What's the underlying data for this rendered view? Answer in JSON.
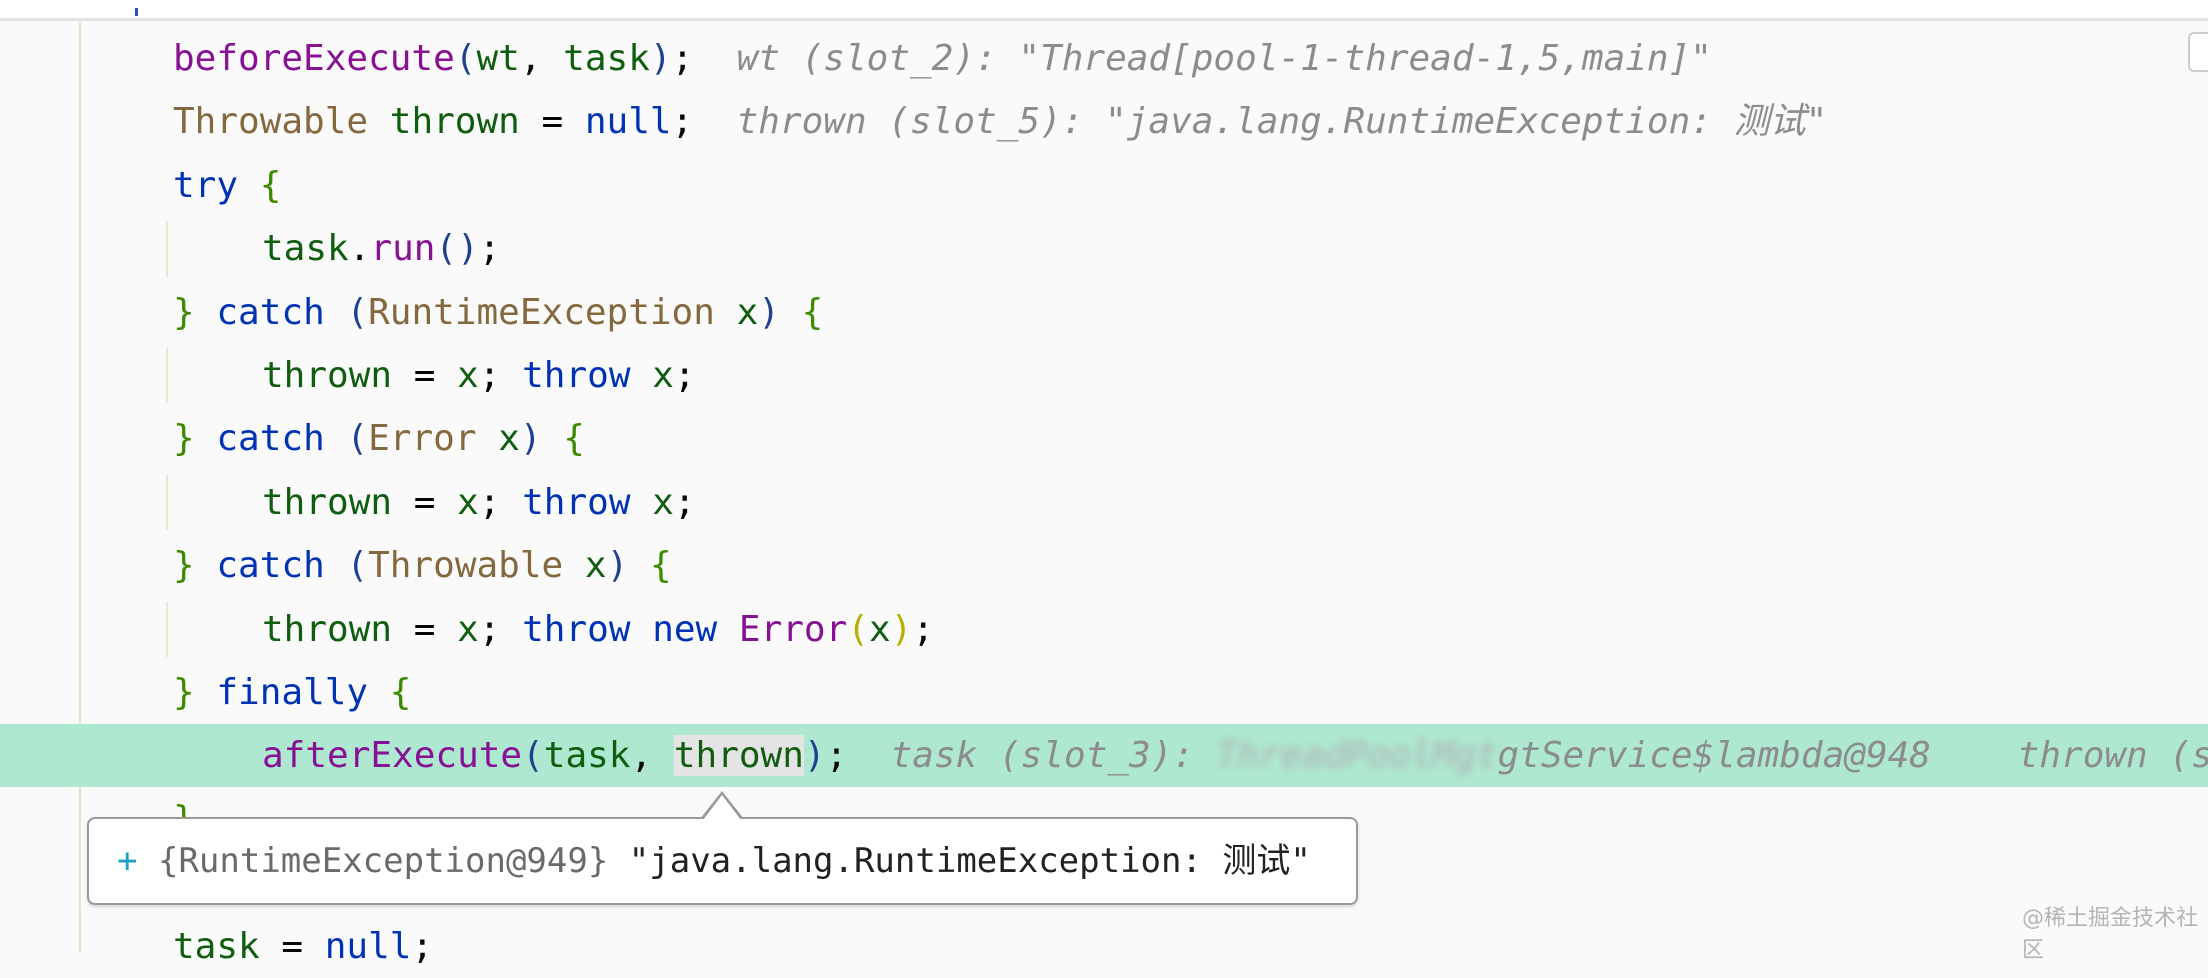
{
  "editor": {
    "lines": [
      {
        "indent": 1,
        "tokens": [
          [
            "beforeExecute",
            "m"
          ],
          [
            "(",
            "p"
          ],
          [
            "wt",
            "v"
          ],
          [
            ", ",
            "d"
          ],
          [
            "task",
            "v"
          ],
          [
            ")",
            "p"
          ],
          [
            ";",
            "d"
          ]
        ],
        "hint": "wt (slot_2): \"Thread[pool-1-thread-1,5,main]\""
      },
      {
        "indent": 1,
        "tokens": [
          [
            "Throwable",
            "t"
          ],
          [
            " ",
            "d"
          ],
          [
            "thrown",
            "v"
          ],
          [
            " = ",
            "d"
          ],
          [
            "null",
            "k"
          ],
          [
            ";",
            "d"
          ]
        ],
        "hint": "thrown (slot_5): \"java.lang.RuntimeException: 测试\""
      },
      {
        "indent": 1,
        "tokens": [
          [
            "try",
            "k"
          ],
          [
            " ",
            "d"
          ],
          [
            "{",
            "b"
          ]
        ]
      },
      {
        "indent": 2,
        "tokens": [
          [
            "task",
            "v"
          ],
          [
            ".",
            "d"
          ],
          [
            "run",
            "m"
          ],
          [
            "()",
            "p"
          ],
          [
            ";",
            "d"
          ]
        ]
      },
      {
        "indent": 1,
        "tokens": [
          [
            "}",
            "b"
          ],
          [
            " ",
            "d"
          ],
          [
            "catch",
            "k"
          ],
          [
            " ",
            "d"
          ],
          [
            "(",
            "p"
          ],
          [
            "RuntimeException",
            "t"
          ],
          [
            " ",
            "d"
          ],
          [
            "x",
            "v"
          ],
          [
            ")",
            "p"
          ],
          [
            " ",
            "d"
          ],
          [
            "{",
            "b"
          ]
        ]
      },
      {
        "indent": 2,
        "tokens": [
          [
            "thrown",
            "v"
          ],
          [
            " = ",
            "d"
          ],
          [
            "x",
            "v"
          ],
          [
            "; ",
            "d"
          ],
          [
            "throw",
            "k"
          ],
          [
            " ",
            "d"
          ],
          [
            "x",
            "v"
          ],
          [
            ";",
            "d"
          ]
        ]
      },
      {
        "indent": 1,
        "tokens": [
          [
            "}",
            "b"
          ],
          [
            " ",
            "d"
          ],
          [
            "catch",
            "k"
          ],
          [
            " ",
            "d"
          ],
          [
            "(",
            "p"
          ],
          [
            "Error",
            "t"
          ],
          [
            " ",
            "d"
          ],
          [
            "x",
            "v"
          ],
          [
            ")",
            "p"
          ],
          [
            " ",
            "d"
          ],
          [
            "{",
            "b"
          ]
        ]
      },
      {
        "indent": 2,
        "tokens": [
          [
            "thrown",
            "v"
          ],
          [
            " = ",
            "d"
          ],
          [
            "x",
            "v"
          ],
          [
            "; ",
            "d"
          ],
          [
            "throw",
            "k"
          ],
          [
            " ",
            "d"
          ],
          [
            "x",
            "v"
          ],
          [
            ";",
            "d"
          ]
        ]
      },
      {
        "indent": 1,
        "tokens": [
          [
            "}",
            "b"
          ],
          [
            " ",
            "d"
          ],
          [
            "catch",
            "k"
          ],
          [
            " ",
            "d"
          ],
          [
            "(",
            "p"
          ],
          [
            "Throwable",
            "t"
          ],
          [
            " ",
            "d"
          ],
          [
            "x",
            "v"
          ],
          [
            ")",
            "p"
          ],
          [
            " ",
            "d"
          ],
          [
            "{",
            "b"
          ]
        ]
      },
      {
        "indent": 2,
        "tokens": [
          [
            "thrown",
            "v"
          ],
          [
            " = ",
            "d"
          ],
          [
            "x",
            "v"
          ],
          [
            "; ",
            "d"
          ],
          [
            "throw",
            "k"
          ],
          [
            " ",
            "d"
          ],
          [
            "new",
            "k"
          ],
          [
            " ",
            "d"
          ],
          [
            "Error",
            "m"
          ],
          [
            "(",
            "y"
          ],
          [
            "x",
            "v"
          ],
          [
            ")",
            "y"
          ],
          [
            ";",
            "d"
          ]
        ]
      },
      {
        "indent": 1,
        "tokens": [
          [
            "}",
            "b"
          ],
          [
            " ",
            "d"
          ],
          [
            "finally",
            "k"
          ],
          [
            " ",
            "d"
          ],
          [
            "{",
            "b"
          ]
        ]
      },
      {
        "indent": 2,
        "highlight": true,
        "tokens": [
          [
            "afterExecute",
            "m"
          ],
          [
            "(",
            "p"
          ],
          [
            "task",
            "v"
          ],
          [
            ", ",
            "d"
          ],
          [
            "thrown",
            "v sel"
          ],
          [
            ")",
            "p"
          ],
          [
            ";",
            "d"
          ]
        ],
        "hint": "task (slot_3): ",
        "hint_blurred": "ThreadPoolMgt",
        "hint_tail": "gtService$lambda@948    thrown (s"
      },
      {
        "indent": 1,
        "tokens": [
          [
            "}",
            "b"
          ]
        ]
      },
      {
        "indent": 1,
        "tokens": []
      },
      {
        "indent": 1,
        "tokens": [
          [
            "task",
            "v"
          ],
          [
            " = ",
            "d"
          ],
          [
            "null",
            "k"
          ],
          [
            ";",
            "d"
          ]
        ]
      }
    ],
    "colors": {
      "execution_line": "#aee8d1",
      "method": "#871094",
      "keyword": "#0033b3",
      "variable": "#0f5d0f",
      "type": "#84693f"
    }
  },
  "tooltip": {
    "expand_icon": "plus-icon",
    "expand_label": "+",
    "type": "{RuntimeException@949}",
    "value": "\"java.lang.RuntimeException: 测试\""
  },
  "watermark": "@稀土掘金技术社区"
}
